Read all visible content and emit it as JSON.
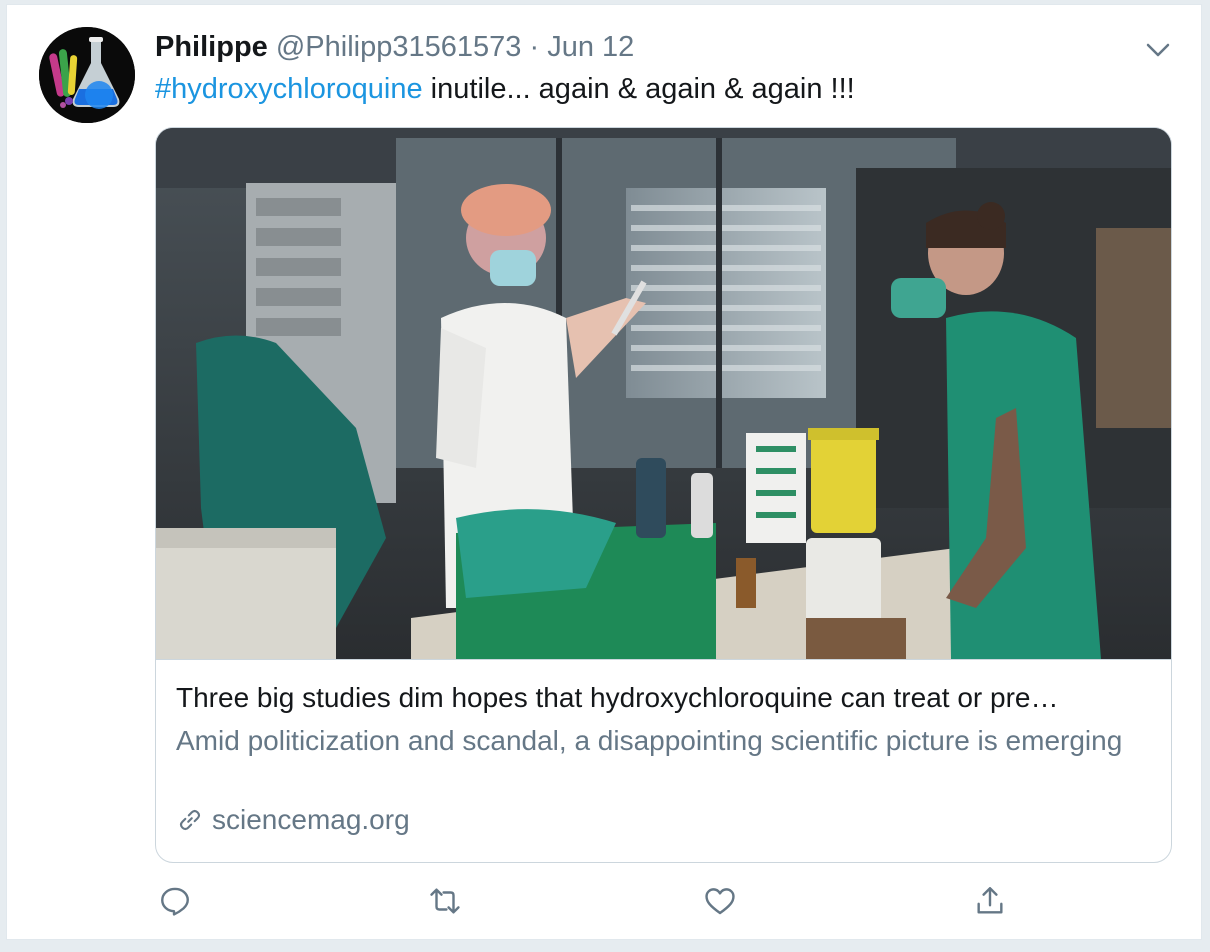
{
  "tweet": {
    "author": {
      "name": "Philippe",
      "handle": "@Philipp31561573",
      "separator": "·",
      "date": "Jun 12"
    },
    "text": {
      "hashtag": "#hydroxychloroquine",
      "body": " inutile... again & again & again !!!"
    },
    "card": {
      "title": "Three big studies dim hopes that hydroxychloroquine can treat or pre…",
      "description": "Amid politicization and scandal, a disappointing scientific picture is emerging",
      "domain": "sciencemag.org",
      "image_icon": "photo-hospital-scene"
    },
    "actions": [
      {
        "name": "reply",
        "icon": "reply-icon"
      },
      {
        "name": "retweet",
        "icon": "retweet-icon"
      },
      {
        "name": "like",
        "icon": "heart-icon"
      },
      {
        "name": "share",
        "icon": "share-icon"
      }
    ]
  },
  "colors": {
    "link": "#1b95e0",
    "secondary_text": "#657786",
    "primary_text": "#14171a",
    "border": "#ccd6dd",
    "background": "#e6ecf0"
  }
}
